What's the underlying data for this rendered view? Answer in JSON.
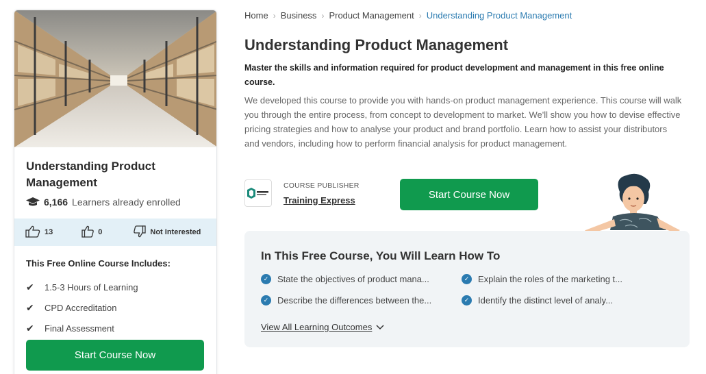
{
  "course_card": {
    "title": "Understanding Product Management",
    "enrolled_count": "6,166",
    "enrolled_label": "Learners already enrolled",
    "likes": "13",
    "dislikes": "0",
    "not_interested_label": "Not Interested",
    "includes_title": "This Free Online Course Includes:",
    "includes": [
      "1.5-3 Hours of Learning",
      "CPD Accreditation",
      "Final Assessment"
    ],
    "start_button": "Start Course Now"
  },
  "breadcrumb": [
    "Home",
    "Business",
    "Product Management",
    "Understanding Product Management"
  ],
  "main": {
    "title": "Understanding Product Management",
    "lead": "Master the skills and information required for product development and management in this free online course.",
    "description": "We developed this course to provide you with hands-on product management experience. This course will walk you through the entire process, from concept to development to market. We'll show you how to devise effective pricing strategies and how to analyse your product and brand portfolio. Learn how to assist your distributors and vendors, including how to perform financial analysis for product management.",
    "publisher_label": "COURSE PUBLISHER",
    "publisher_name": "Training Express",
    "start_button": "Start Course Now"
  },
  "learn": {
    "title": "In This Free Course, You Will Learn How To",
    "outcomes": [
      "State the objectives of product mana...",
      "Explain the roles of the marketing t...",
      "Describe the differences between the...",
      "Identify the distinct level of analy..."
    ],
    "view_all": "View All Learning Outcomes"
  },
  "colors": {
    "primary_green": "#109a4e",
    "link_blue": "#2b7bb0",
    "vote_bar_bg": "#e3f0f7",
    "learn_box_bg": "#f1f4f6"
  },
  "icons": [
    "graduation-cap-icon",
    "thumbs-up-icon",
    "thumbs-down-icon",
    "checkmark-icon",
    "check-circle-icon",
    "chevron-down-icon",
    "chevron-right-icon"
  ]
}
